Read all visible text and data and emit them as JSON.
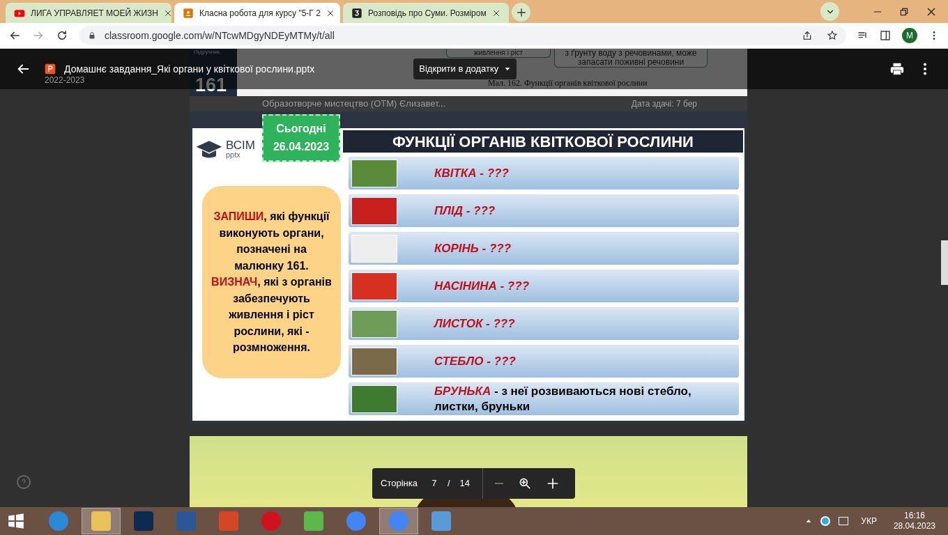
{
  "browser": {
    "tabs": [
      {
        "title": "ЛИГА УПРАВЛЯЕТ МОЕЙ ЖИЗН",
        "selected": false
      },
      {
        "title": "Класна робота для курсу \"5-Г 2",
        "selected": true
      },
      {
        "title": "Розповідь про Суми. Розміром",
        "selected": false
      }
    ],
    "url": "classroom.google.com/w/NTcwMDgyNDEyMTMy/t/all",
    "profile": "M"
  },
  "background_page": {
    "year": "2022-2023",
    "item": "Образотворче мистецтво (ОТМ) Єлизавет...",
    "due": "Дата здачі: 7 бер"
  },
  "previous_slide": {
    "caption_small": "Підручник.",
    "page": "161",
    "box_1": "живлення і ріст",
    "box_2": "з ґрунту воду з речовинами, може запасати поживні речовини",
    "figure_caption": "Мал. 162. Функції органів квіткової рослини"
  },
  "viewer": {
    "file_name": "Домашнє завдання_Які органи у квіткової рослини.pptx",
    "open_with": "Відкрити в додатку",
    "page_nav": {
      "label": "Сторінка",
      "current": "7",
      "separator": "/",
      "total": "14"
    }
  },
  "slide": {
    "date_badge": [
      "Сьогодні",
      "26.04.2023"
    ],
    "logo": {
      "name": "ВСІМ",
      "sub": "pptx"
    },
    "title": "ФУНКЦІЇ ОРГАНІВ КВІТКОВОЇ РОСЛИНИ",
    "instruction": [
      {
        "text": "ЗАПИШИ",
        "emphasis": true
      },
      {
        "text": ", які функції виконують органи, позначені на малюнку 161. ",
        "emphasis": false
      },
      {
        "text": "ВИЗНАЧ",
        "emphasis": true
      },
      {
        "text": ", які з органів забезпечують живлення і ріст рослини, які - розмноження.",
        "emphasis": false
      }
    ],
    "rows": [
      {
        "term": "КВІТКА",
        "description": "- ???",
        "answered": false
      },
      {
        "term": "ПЛІД",
        "description": "- ???",
        "answered": false
      },
      {
        "term": "КОРІНЬ",
        "description": "- ???",
        "answered": false
      },
      {
        "term": "НАСІНИНА",
        "description": "- ???",
        "answered": false
      },
      {
        "term": "ЛИСТОК",
        "description": "- ???",
        "answered": false
      },
      {
        "term": "СТЕБЛО",
        "description": "- ???",
        "answered": false
      },
      {
        "term": "БРУНЬКА",
        "description": "- з неї розвиваються нові стебло, листки, бруньки",
        "answered": true
      }
    ]
  },
  "taskbar": {
    "apps": [
      {
        "selected": false
      },
      {
        "selected": true
      },
      {
        "selected": false
      },
      {
        "selected": false
      },
      {
        "selected": false
      },
      {
        "selected": false
      },
      {
        "selected": false
      },
      {
        "selected": false
      },
      {
        "selected": true
      },
      {
        "selected": false
      }
    ],
    "language": "УКР",
    "time": "16:16",
    "date": "28.04.2023"
  }
}
